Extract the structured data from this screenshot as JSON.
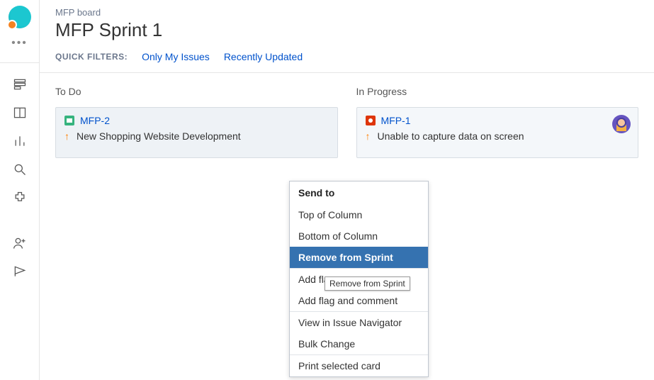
{
  "board_name": "MFP board",
  "sprint_title": "MFP Sprint 1",
  "filters": {
    "label": "QUICK FILTERS:",
    "only_my": "Only My Issues",
    "recent": "Recently Updated"
  },
  "columns": {
    "todo": {
      "title": "To Do"
    },
    "inprogress": {
      "title": "In Progress"
    }
  },
  "cards": {
    "mfp2": {
      "key": "MFP-2",
      "summary": "New Shopping Website Development"
    },
    "mfp1": {
      "key": "MFP-1",
      "summary": "Unable to capture data on screen"
    }
  },
  "ctx": {
    "send_to": "Send to",
    "top": "Top of Column",
    "bottom": "Bottom of Column",
    "remove": "Remove from Sprint",
    "addflag": "Add flag",
    "addflagc": "Add flag and comment",
    "viewnav": "View in Issue Navigator",
    "bulk": "Bulk Change",
    "print": "Print selected card"
  },
  "tooltip": "Remove from Sprint"
}
